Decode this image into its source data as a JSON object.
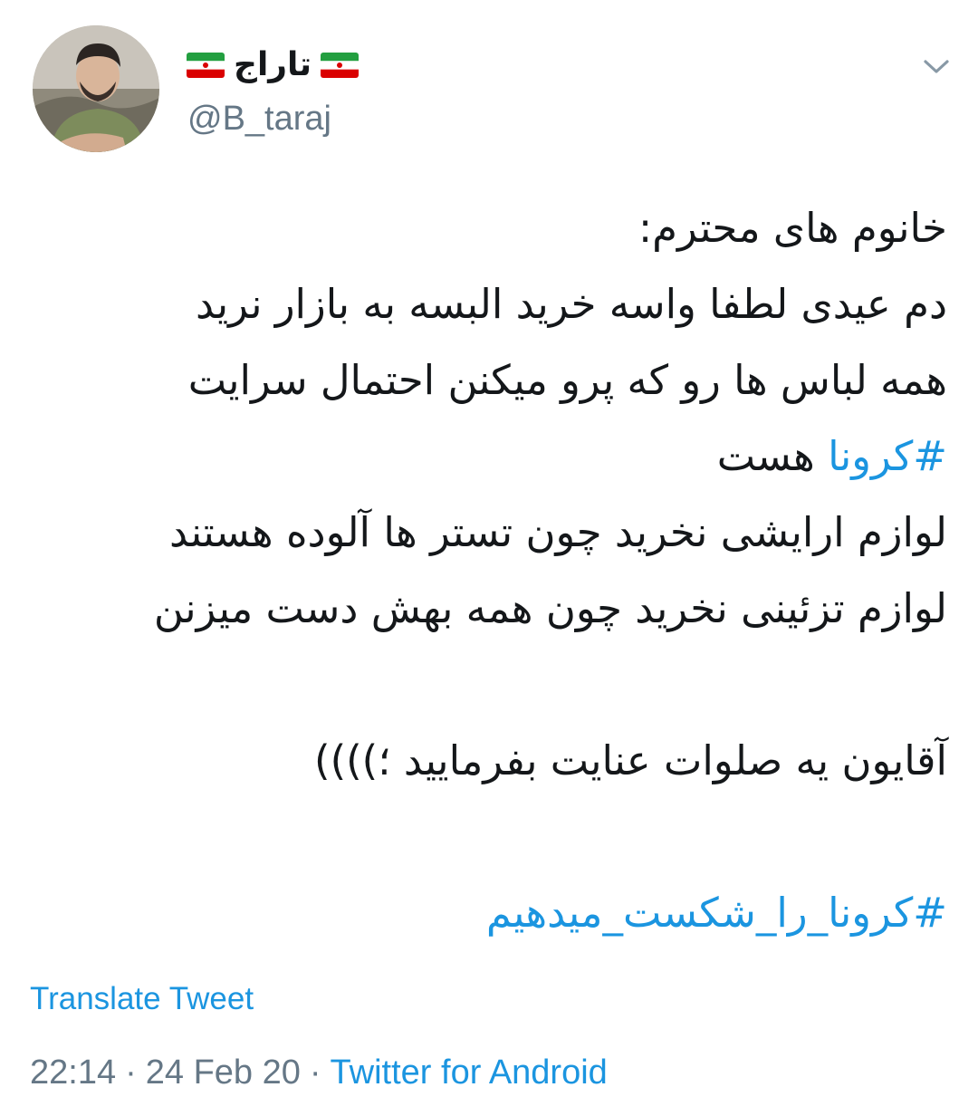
{
  "author": {
    "display_name": "تاراج",
    "handle": "@B_taraj",
    "flag_icon": "iran-flag-icon",
    "avatar_icon": "profile-photo"
  },
  "menu_icon": "chevron-down-icon",
  "tweet": {
    "lines": [
      "خانوم های محترم:",
      "دم عیدی لطفا واسه خرید البسه به بازار نرید",
      "همه لباس ها رو که پرو میکنن احتمال سرایت"
    ],
    "line4_hashtag": "#کرونا",
    "line4_rest": " هست",
    "lines_after": [
      "لوازم ارایشی نخرید چون تستر ها آلوده هستند",
      "لوازم تزئینی نخرید چون همه بهش دست میزنن"
    ],
    "closing": "آقایون یه صلوات عنایت بفرمایید ؛))))",
    "hashtag_footer": "#کرونا_را_شکست_میدهیم"
  },
  "translate_label": "Translate Tweet",
  "meta": {
    "time": "22:14",
    "date": "24 Feb 20",
    "separator": "·",
    "source": "Twitter for Android"
  },
  "colors": {
    "link": "#1b95e0",
    "secondary": "#657786",
    "text": "#14171a"
  }
}
